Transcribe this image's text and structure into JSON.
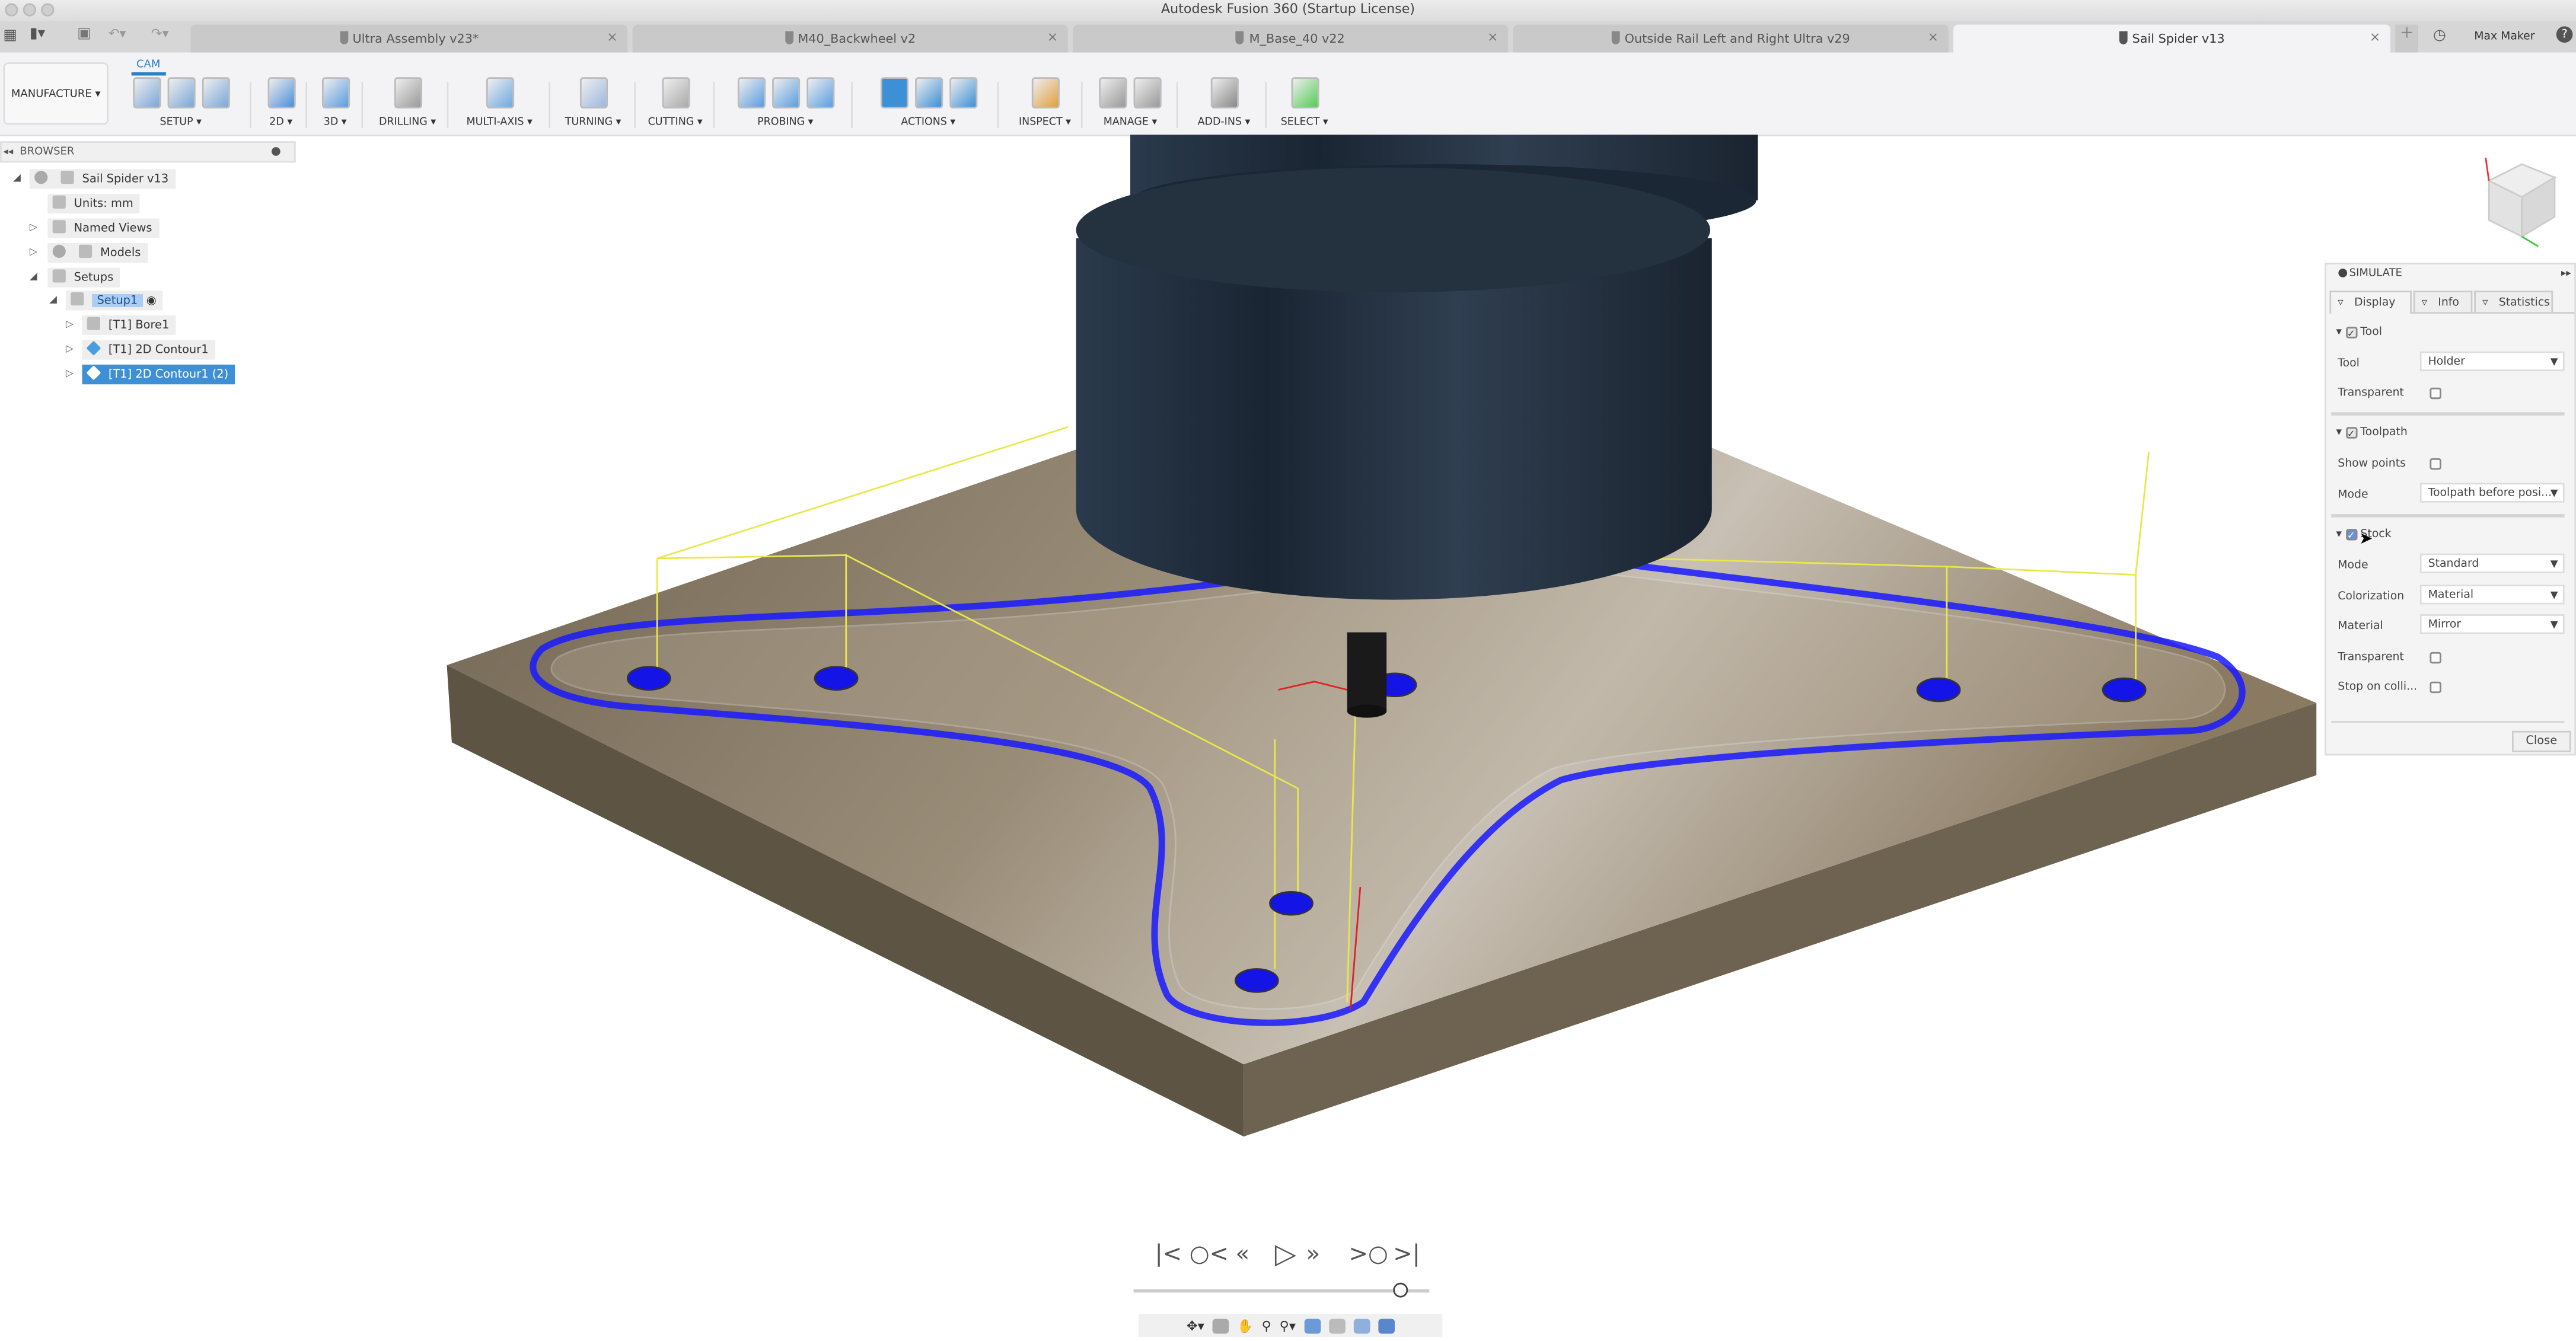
{
  "window": {
    "title": "Autodesk Fusion 360 (Startup License)"
  },
  "tabs": [
    {
      "label": "Ultra Assembly v23*",
      "active": false
    },
    {
      "label": "M40_Backwheel v2",
      "active": false
    },
    {
      "label": "M_Base_40 v22",
      "active": false
    },
    {
      "label": "Outside Rail Left and Right Ultra v29",
      "active": false
    },
    {
      "label": "Sail Spider v13",
      "active": true
    }
  ],
  "user": {
    "name": "Max Maker"
  },
  "toolbar": {
    "workspace": "MANUFACTURE ▾",
    "tab": "CAM",
    "groups": [
      {
        "label": "SETUP ▾",
        "icons": [
          "new-setup-icon",
          "nc-program-icon",
          "folder-icon"
        ]
      },
      {
        "label": "2D ▾",
        "icons": [
          "2d-pocket-icon"
        ]
      },
      {
        "label": "3D ▾",
        "icons": [
          "3d-adaptive-icon"
        ]
      },
      {
        "label": "DRILLING ▾",
        "icons": [
          "drill-icon"
        ]
      },
      {
        "label": "MULTI-AXIS ▾",
        "icons": [
          "multi-axis-icon"
        ]
      },
      {
        "label": "TURNING ▾",
        "icons": [
          "turning-icon"
        ]
      },
      {
        "label": "CUTTING ▾",
        "icons": [
          "cutting-icon"
        ]
      },
      {
        "label": "PROBING ▾",
        "icons": [
          "wcs-probe-icon",
          "probe-icon",
          "probe-geometry-icon"
        ]
      },
      {
        "label": "ACTIONS ▾",
        "icons": [
          "simulate-icon",
          "post-process-icon",
          "setup-sheet-icon"
        ]
      },
      {
        "label": "INSPECT ▾",
        "icons": [
          "measure-icon"
        ]
      },
      {
        "label": "MANAGE ▾",
        "icons": [
          "tool-library-icon",
          "task-manager-icon"
        ]
      },
      {
        "label": "ADD-INS ▾",
        "icons": [
          "scripts-icon"
        ]
      },
      {
        "label": "SELECT ▾",
        "icons": [
          "select-icon"
        ]
      }
    ]
  },
  "browser": {
    "title": "BROWSER",
    "items": [
      {
        "label": "Sail Spider v13"
      },
      {
        "label": "Units: mm"
      },
      {
        "label": "Named Views"
      },
      {
        "label": "Models"
      },
      {
        "label": "Setups"
      },
      {
        "label": "Setup1"
      },
      {
        "label": "[T1] Bore1"
      },
      {
        "label": "[T1] 2D Contour1"
      },
      {
        "label": "[T1] 2D Contour1 (2)",
        "selected": true
      }
    ]
  },
  "simulate": {
    "title": "SIMULATE",
    "tabs": [
      "Display",
      "Info",
      "Statistics"
    ],
    "tool": {
      "section": "Tool",
      "checked": true,
      "tool_label": "Tool",
      "tool_value": "Holder",
      "transparent_label": "Transparent",
      "transparent": false
    },
    "toolpath": {
      "section": "Toolpath",
      "checked": true,
      "show_points_label": "Show points",
      "show_points": false,
      "mode_label": "Mode",
      "mode_value": "Toolpath before posi..."
    },
    "stock": {
      "section": "Stock",
      "checked": true,
      "mode_label": "Mode",
      "mode_value": "Standard",
      "colorization_label": "Colorization",
      "colorization_value": "Material",
      "material_label": "Material",
      "material_value": "Mirror",
      "transparent_label": "Transparent",
      "transparent": false,
      "stop_label": "Stop on colli...",
      "stop": false
    },
    "close": "Close"
  },
  "playback": {
    "position": 0.9
  },
  "colors": {
    "accent": "#3d8fd6",
    "toolpath": "#1a1aff",
    "rapid": "#e8e84a",
    "stock": "#8a7a62",
    "holder": "#1e2d3d"
  }
}
